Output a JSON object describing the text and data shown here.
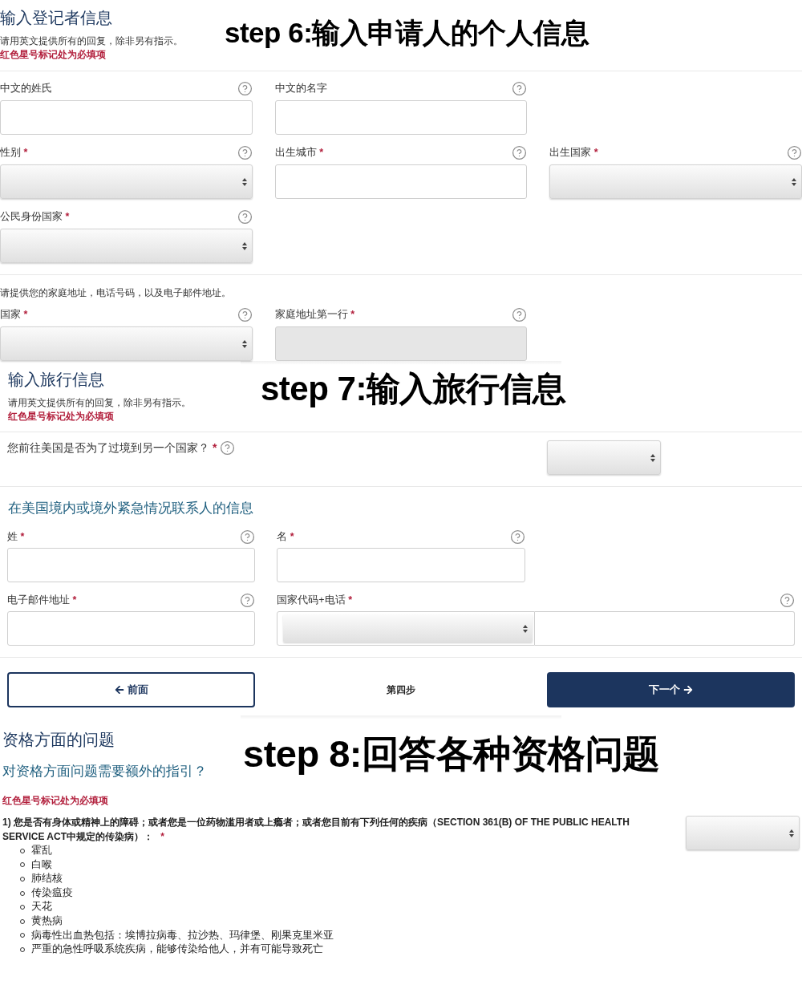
{
  "personal_info": {
    "step_caption": "step 6:输入申请人的个人信息",
    "title": "输入登记者信息",
    "instructions": "请用英文提供所有的回复，除非另有指示。",
    "required_note": "红色星号标记处为必填项",
    "field_rows": [
      [
        {
          "label": "中文的姓氏",
          "kind": "text"
        },
        {
          "label": "中文的名字",
          "kind": "text"
        }
      ],
      [
        {
          "label": "性别",
          "required_mark": "*",
          "kind": "select"
        },
        {
          "label": "出生城市",
          "required_mark": "*",
          "kind": "text"
        },
        {
          "label": "出生国家",
          "required_mark": "*",
          "kind": "select"
        }
      ],
      [
        {
          "label": "公民身份国家",
          "required_mark": "*",
          "kind": "select"
        }
      ]
    ],
    "address_note": "请提供您的家庭地址，电话号码，以及电子邮件地址。",
    "address_fields": [
      {
        "label": "国家",
        "required_mark": "*",
        "kind": "select",
        "disabled": false
      },
      {
        "label": "家庭地址第一行",
        "required_mark": "*",
        "kind": "text",
        "disabled": true
      }
    ]
  },
  "travel_info": {
    "step_caption": "step 7:输入旅行信息",
    "title": "输入旅行信息",
    "instructions": "请用英文提供所有的回复，除非另有指示。",
    "required_note": "红色星号标记处为必填项",
    "transit_question": {
      "text": "您前往美国是否为了过境到另一个国家？",
      "required_mark": "*"
    },
    "contact_heading": "在美国境内或境外紧急情况联系人的信息",
    "contact_rows": [
      [
        {
          "label": "姓",
          "required_mark": "*",
          "kind": "text"
        },
        {
          "label": "名",
          "required_mark": "*",
          "kind": "text"
        }
      ],
      [
        {
          "label": "电子邮件地址",
          "required_mark": "*",
          "kind": "text"
        },
        {
          "label": "国家代码+电话",
          "required_mark": "*",
          "kind": "phone"
        }
      ]
    ],
    "back_button": "前面",
    "step_indicator": "第四步",
    "next_button": "下一个"
  },
  "eligibility": {
    "step_caption": "step 8:回答各种资格问题",
    "title": "资格方面的问题",
    "guidance_link": "对资格方面问题需要额外的指引？",
    "required_note": "红色星号标记处为必填项",
    "questions": [
      {
        "text": "1) 您是否有身体或精神上的障碍；或者您是一位药物滥用者或上瘾者；或者您目前有下列任何的疾病（SECTION 361(B) OF THE PUBLIC HEALTH SERVICE ACT中规定的传染病）：",
        "required_mark": "*",
        "conditions": [
          "霍乱",
          "白喉",
          "肺结核",
          "传染瘟疫",
          "天花",
          "黄热病",
          "病毒性出血热包括：埃博拉病毒、拉沙热、玛律堡、刚果克里米亚",
          "严重的急性呼吸系统疾病，能够传染给他人，并有可能导致死亡"
        ]
      }
    ]
  }
}
